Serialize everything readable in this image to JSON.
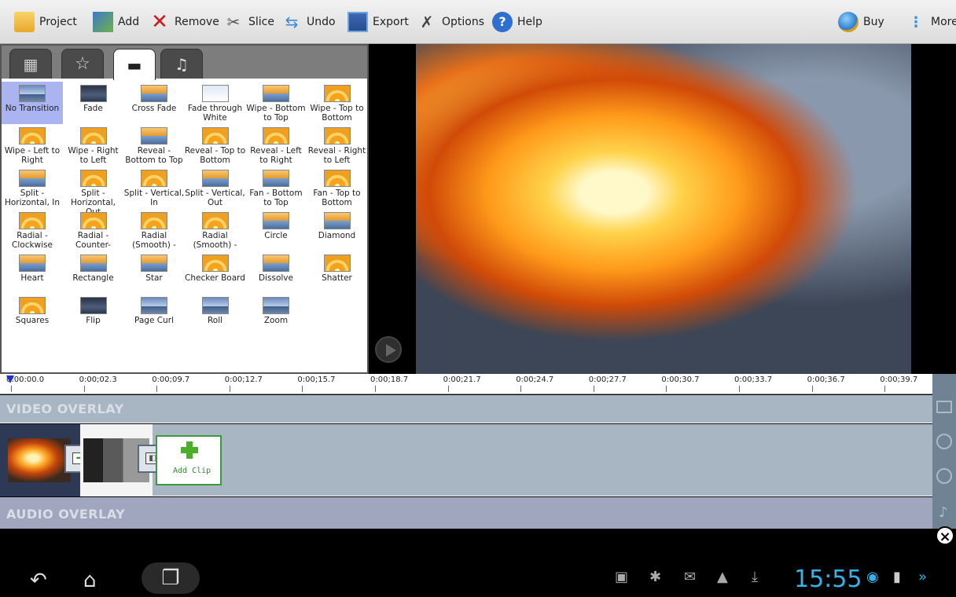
{
  "toolbar": {
    "project": "Project",
    "add": "Add",
    "remove": "Remove",
    "slice": "Slice",
    "undo": "Undo",
    "export": "Export",
    "options": "Options",
    "help": "Help",
    "buy": "Buy",
    "more": "More"
  },
  "tabs": [
    {
      "icon": "film-icon"
    },
    {
      "icon": "star-icon"
    },
    {
      "icon": "clapperboard-icon",
      "active": true
    },
    {
      "icon": "microphone-icon"
    }
  ],
  "transitions": [
    {
      "label": "No Transition",
      "style": "sky",
      "selected": true
    },
    {
      "label": "Fade",
      "style": "dark"
    },
    {
      "label": "Cross Fade",
      "style": "mix"
    },
    {
      "label": "Fade through White",
      "style": "white"
    },
    {
      "label": "Wipe - Bottom to Top",
      "style": "mix"
    },
    {
      "label": "Wipe - Top to Bottom",
      "style": "sun"
    },
    {
      "label": "Wipe - Left to Right",
      "style": "sun"
    },
    {
      "label": "Wipe - Right to Left",
      "style": "sun"
    },
    {
      "label": "Reveal - Bottom to Top",
      "style": "mix"
    },
    {
      "label": "Reveal - Top to Bottom",
      "style": "sun"
    },
    {
      "label": "Reveal - Left to Right",
      "style": "sun"
    },
    {
      "label": "Reveal - Right to Left",
      "style": "sun"
    },
    {
      "label": "Split - Horizontal, In",
      "style": "mix"
    },
    {
      "label": "Split - Horizontal, Out",
      "style": "sun"
    },
    {
      "label": "Split - Vertical, In",
      "style": "sun"
    },
    {
      "label": "Split - Vertical, Out",
      "style": "mix"
    },
    {
      "label": "Fan - Bottom to Top",
      "style": "mix"
    },
    {
      "label": "Fan - Top to Bottom",
      "style": "sun"
    },
    {
      "label": "Radial - Clockwise",
      "style": "sun"
    },
    {
      "label": "Radial - Counter-",
      "style": "sun"
    },
    {
      "label": "Radial (Smooth) -",
      "style": "sun"
    },
    {
      "label": "Radial (Smooth) -",
      "style": "sun"
    },
    {
      "label": "Circle",
      "style": "mix"
    },
    {
      "label": "Diamond",
      "style": "mix"
    },
    {
      "label": "Heart",
      "style": "mix"
    },
    {
      "label": "Rectangle",
      "style": "mix"
    },
    {
      "label": "Star",
      "style": "mix"
    },
    {
      "label": "Checker Board",
      "style": "sun"
    },
    {
      "label": "Dissolve",
      "style": "mix"
    },
    {
      "label": "Shatter",
      "style": "sun"
    },
    {
      "label": "Squares",
      "style": "sun"
    },
    {
      "label": "Flip",
      "style": "dark"
    },
    {
      "label": "Page Curl",
      "style": "sky"
    },
    {
      "label": "Roll",
      "style": "sky"
    },
    {
      "label": "Zoom",
      "style": "sky"
    }
  ],
  "ruler": [
    "0:00:00.0",
    "0:00;02.3",
    "0:00;09.7",
    "0:00;12.7",
    "0:00;15.7",
    "0:00;18.7",
    "0:00;21.7",
    "0:00;24.7",
    "0:00;27.7",
    "0:00;30.7",
    "0:00;33.7",
    "0:00;36.7",
    "0:00;39.7"
  ],
  "tracks": {
    "video_overlay": "VIDEO OVERLAY",
    "audio_overlay": "AUDIO OVERLAY",
    "add_clip": "Add Clip"
  },
  "status": {
    "time": "15:55"
  },
  "colors": {
    "accent": "#36b2e8",
    "selected": "#aab4f0",
    "add_clip_green": "#4caf2a"
  }
}
